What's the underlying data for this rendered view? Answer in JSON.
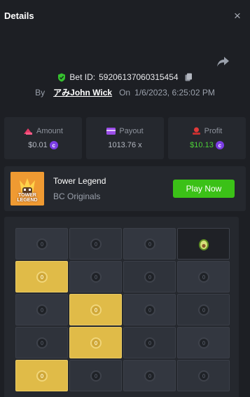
{
  "header": {
    "title": "Details",
    "close_label": "×"
  },
  "bet": {
    "id_label": "Bet ID:",
    "id": "592061370603154​54",
    "by_label": "By",
    "user": "アみJohn Wick",
    "on_label": "On",
    "date": "1/6/2023, 6:25:02 PM"
  },
  "stats": {
    "amount": {
      "label": "Amount",
      "value": "$0.01"
    },
    "payout": {
      "label": "Payout",
      "value": "1013.76 x"
    },
    "profit": {
      "label": "Profit",
      "value": "$10.13"
    }
  },
  "game": {
    "name": "Tower Legend",
    "provider": "BC Originals",
    "play_label": "Play Now",
    "thumb_text": "TOWER LEGEND"
  },
  "board": {
    "rows": [
      [
        "empty",
        "empty",
        "empty",
        "found"
      ],
      [
        "gold",
        "empty",
        "empty",
        "empty"
      ],
      [
        "empty",
        "gold",
        "empty",
        "empty"
      ],
      [
        "empty",
        "gold",
        "empty",
        "empty"
      ],
      [
        "gold",
        "empty",
        "empty",
        "empty"
      ]
    ]
  },
  "colors": {
    "accent_green": "#3bc117",
    "profit_green": "#4cd137",
    "coin_purple": "#7b3de4",
    "tile_gold": "#e0bb48",
    "background": "#1d1f24"
  },
  "icons": [
    "close-icon",
    "share-icon",
    "shield-check-icon",
    "copy-icon",
    "amount-icon",
    "payout-icon",
    "profit-icon",
    "coin-icon",
    "avocado-icon"
  ]
}
